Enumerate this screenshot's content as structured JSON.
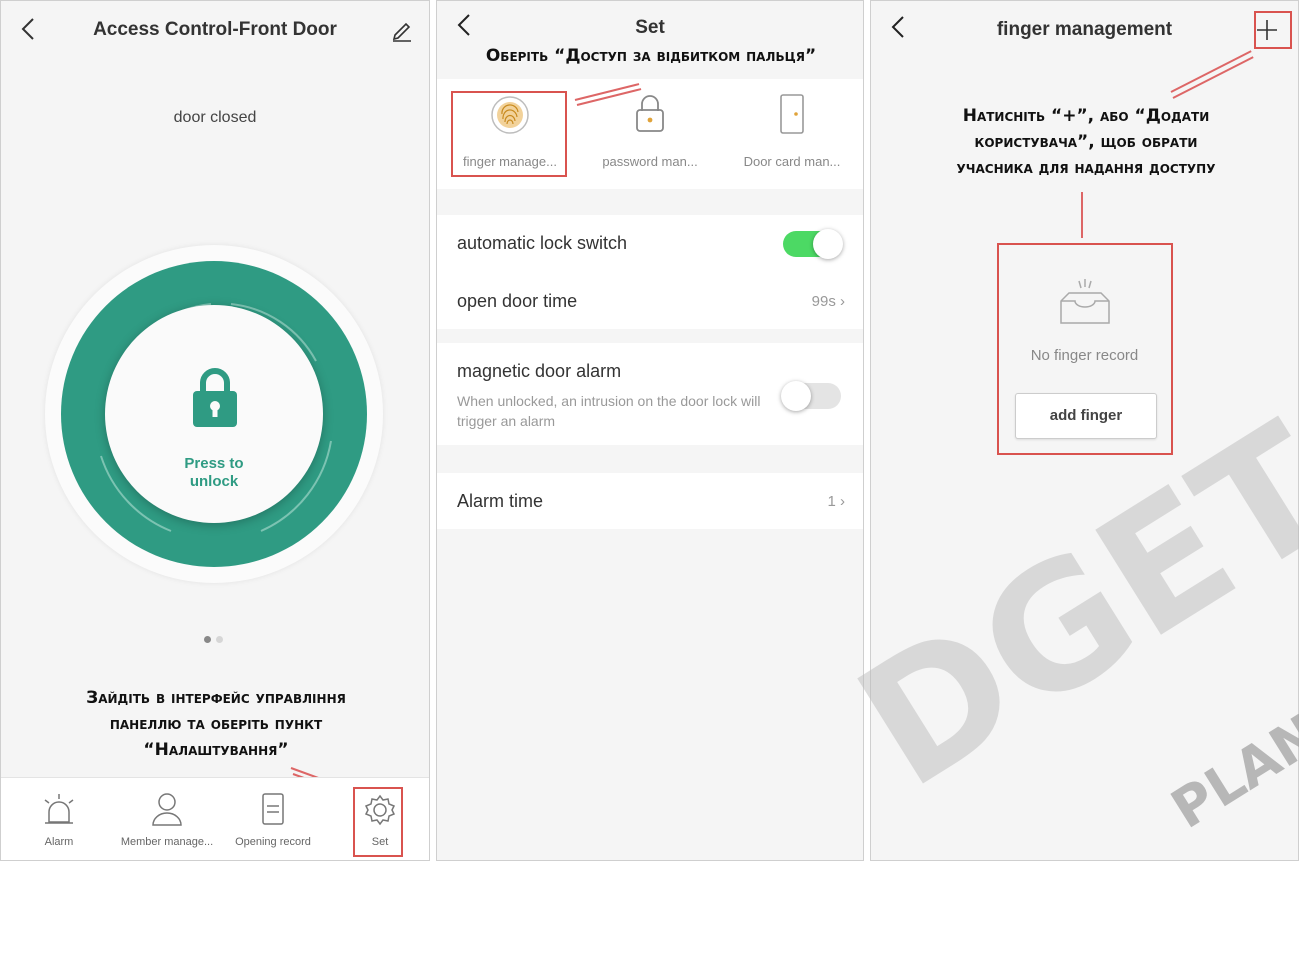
{
  "panel1": {
    "title": "Access Control-Front Door",
    "door_status": "door closed",
    "unlock_label_line1": "Press to",
    "unlock_label_line2": "unlock",
    "annotation": [
      "Зайдіть в інтерфейс управління",
      "панеллю та оберіть пункт",
      "“Налаштування”"
    ],
    "tabs": [
      {
        "label": "Alarm",
        "icon": "alarm-icon"
      },
      {
        "label": "Member manage...",
        "icon": "member-icon"
      },
      {
        "label": "Opening record",
        "icon": "record-icon"
      },
      {
        "label": "Set",
        "icon": "gear-icon"
      }
    ],
    "colors": {
      "accent": "#2f9b83"
    }
  },
  "panel2": {
    "title": "Set",
    "annotation": "Оберіть “Доступ за відбитком пальця”",
    "icons": [
      {
        "label": "finger manage...",
        "icon": "fingerprint-icon"
      },
      {
        "label": "password man...",
        "icon": "padlock-icon"
      },
      {
        "label": "Door card man...",
        "icon": "door-card-icon"
      }
    ],
    "auto_lock": {
      "label": "automatic lock switch",
      "on": true
    },
    "open_door_time": {
      "label": "open door time",
      "value": "99s"
    },
    "magnetic_alarm": {
      "label": "magnetic door alarm",
      "desc": "When unlocked, an intrusion on the door lock will trigger an alarm",
      "on": false
    },
    "alarm_time": {
      "label": "Alarm time",
      "value": "1"
    },
    "colors": {
      "toggle_on": "#4cd964"
    }
  },
  "panel3": {
    "title": "finger management",
    "annotation": [
      "Натисніть “+”, або “Додати",
      "користувача”, щоб обрати",
      "учасника для надання доступу"
    ],
    "empty_message": "No finger record",
    "add_button": "add finger"
  },
  "watermark": {
    "big": "DGET",
    "small": "PLAN"
  }
}
